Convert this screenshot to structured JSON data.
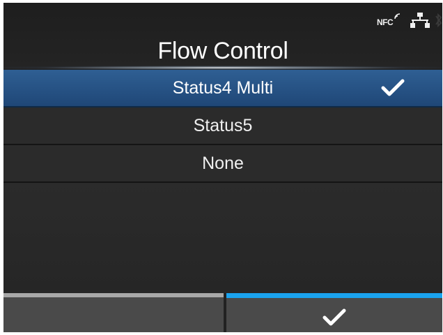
{
  "header": {
    "title": "Flow Control",
    "nfc_label": "NFC",
    "icons": [
      "nfc-icon",
      "network-icon",
      "bluetooth-icon"
    ]
  },
  "options": [
    {
      "label": "Status4 Multi",
      "selected": true
    },
    {
      "label": "Status5",
      "selected": false
    },
    {
      "label": "None",
      "selected": false
    }
  ],
  "softkeys": {
    "left": {
      "icon": "none"
    },
    "right": {
      "icon": "checkmark-icon"
    }
  },
  "colors": {
    "selected_row": "#2a5587",
    "confirm_accent": "#1aa3ef",
    "left_key_accent": "#a8a8a8",
    "background": "#222222"
  }
}
